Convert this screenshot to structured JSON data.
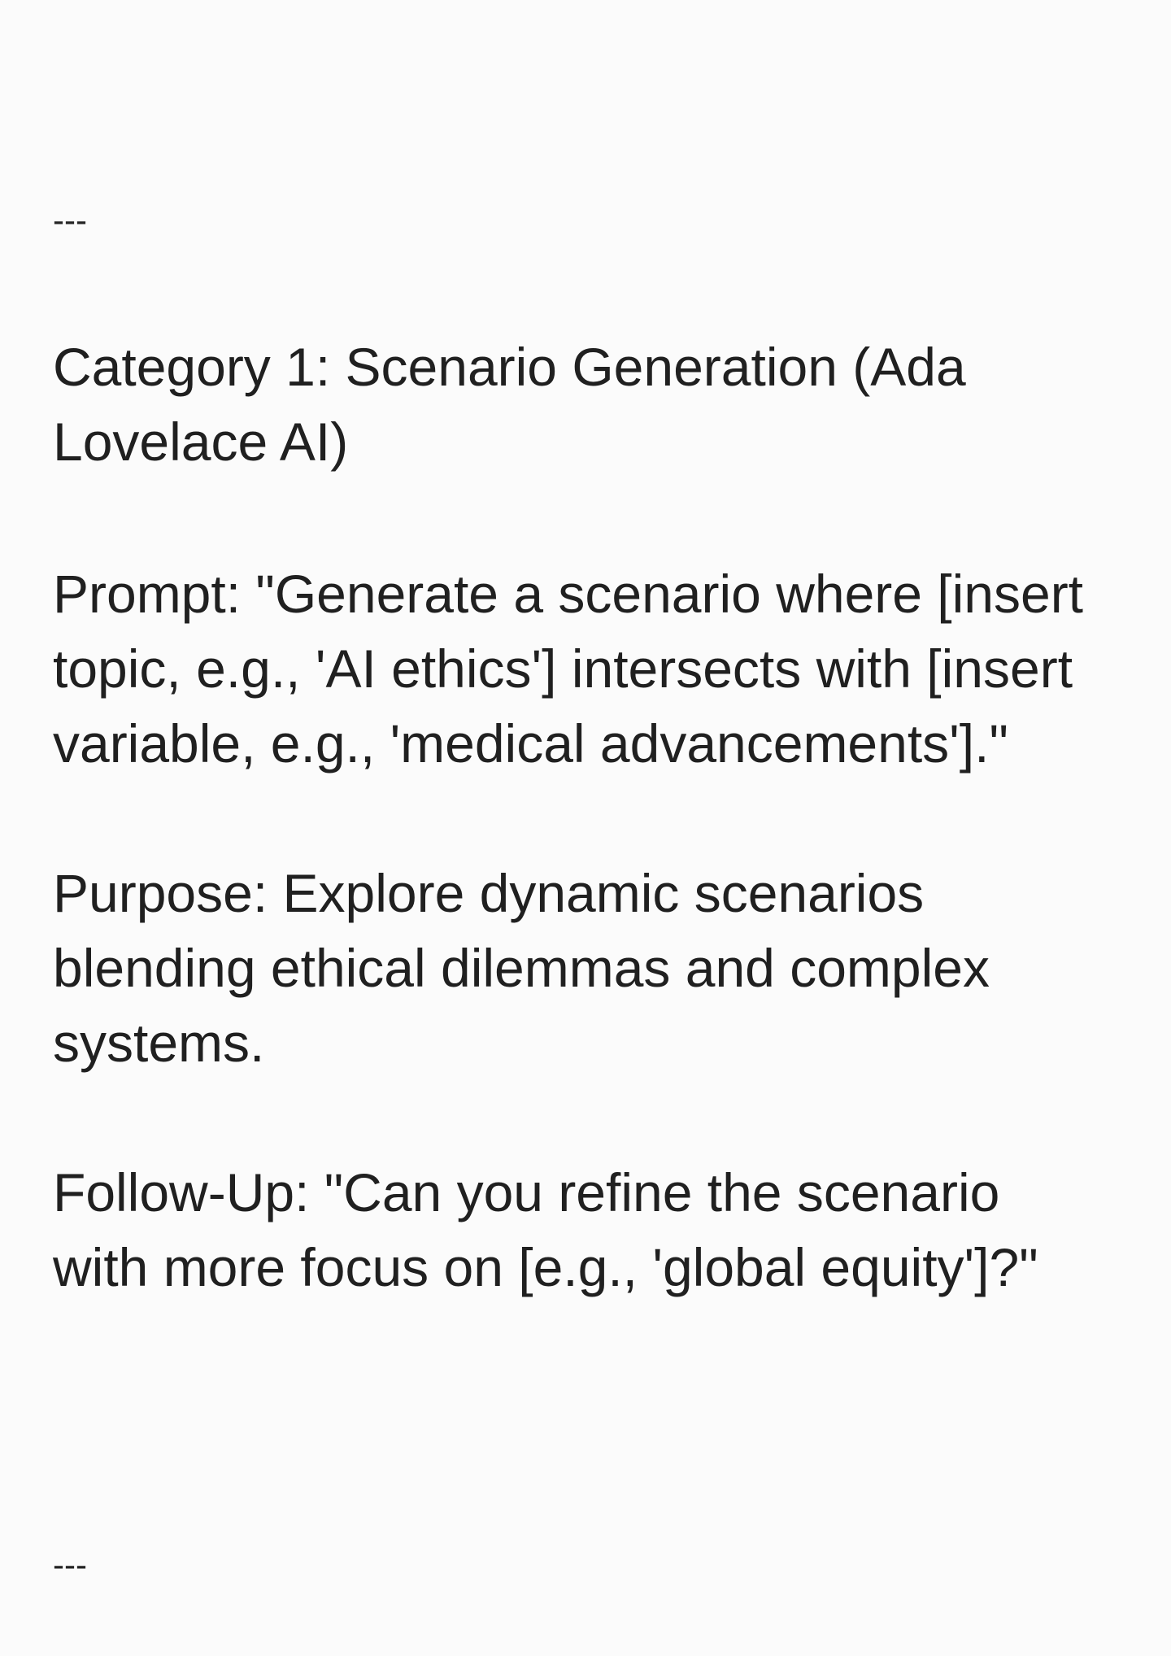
{
  "document": {
    "top_divider": "---",
    "bottom_divider": "---",
    "title_lines": [
      "Category 1: Scenario Generation (Ada",
      "Lovelace AI)"
    ],
    "prompt_lines": [
      "Prompt: \"Generate a scenario where [insert",
      "topic, e.g., 'AI ethics'] intersects with [insert",
      "variable, e.g., 'medical advancements'].\""
    ],
    "purpose_lines": [
      "Purpose: Explore dynamic scenarios",
      "blending ethical dilemmas and complex",
      "systems."
    ],
    "followup_lines": [
      "Follow-Up: \"Can you refine the scenario",
      "with more focus on [e.g., 'global equity']?\""
    ]
  },
  "colors": {
    "background": "#fbfbfb",
    "text": "#202020"
  }
}
